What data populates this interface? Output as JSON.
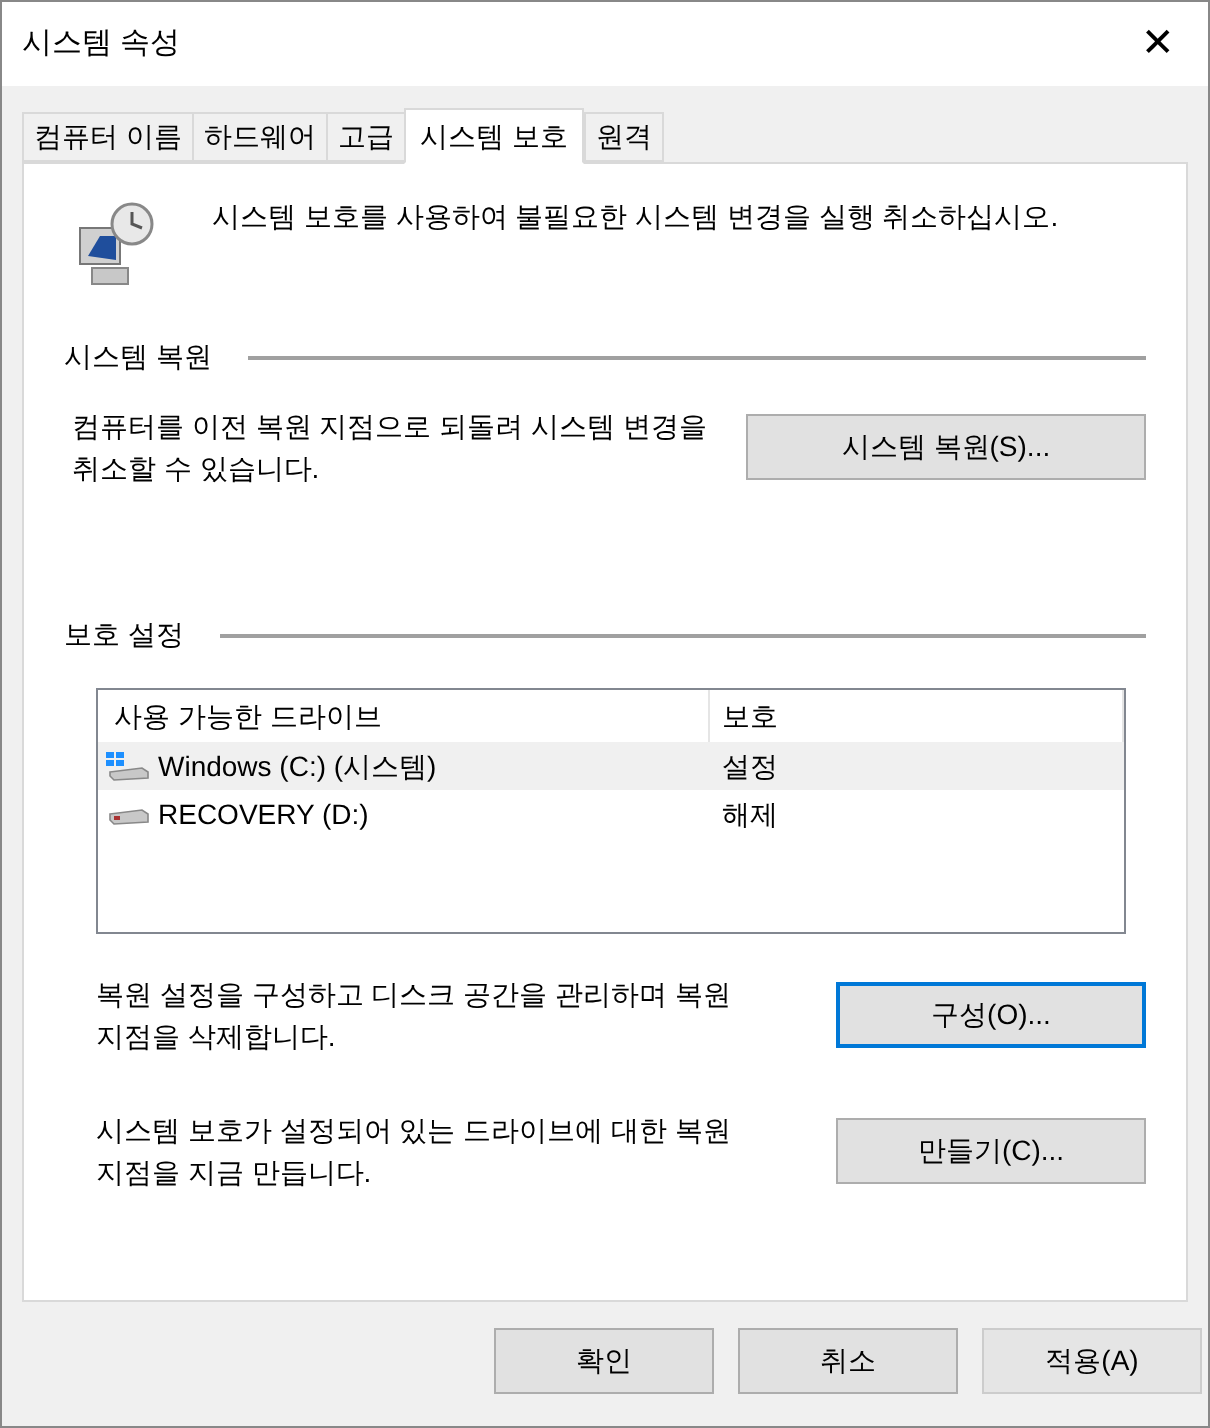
{
  "window": {
    "title": "시스템 속성",
    "close": "✕"
  },
  "tabs": [
    {
      "label": "컴퓨터 이름",
      "selected": false
    },
    {
      "label": "하드웨어",
      "selected": false
    },
    {
      "label": "고급",
      "selected": false
    },
    {
      "label": "시스템 보호",
      "selected": true
    },
    {
      "label": "원격",
      "selected": false
    }
  ],
  "intro": "시스템 보호를 사용하여 불필요한 시스템 변경을 실행 취소하십시오.",
  "restore_section": {
    "title": "시스템 복원",
    "text": "컴퓨터를 이전 복원 지점으로 되돌려 시스템 변경을 취소할 수 있습니다.",
    "button": {
      "label": "시스템 복원(S)...",
      "focused": false,
      "disabled": false
    }
  },
  "protection_section": {
    "title": "보호 설정",
    "columns": [
      "사용 가능한 드라이브",
      "보호"
    ],
    "drives": [
      {
        "kind": "system",
        "name": "Windows (C:) (시스템)",
        "protection": "설정",
        "selected": true
      },
      {
        "kind": "disk",
        "name": "RECOVERY (D:)",
        "protection": "해제",
        "selected": false
      }
    ],
    "actions": [
      {
        "text": "복원 설정을 구성하고 디스크 공간을 관리하며 복원 지점을 삭제합니다.",
        "button": {
          "label": "구성(O)...",
          "focused": true,
          "disabled": false
        }
      },
      {
        "text": "시스템 보호가 설정되어 있는 드라이브에 대한 복원 지점을 지금 만듭니다.",
        "button": {
          "label": "만들기(C)...",
          "focused": false,
          "disabled": false
        }
      }
    ]
  },
  "footer_buttons": [
    {
      "label": "확인",
      "focused": false,
      "disabled": false
    },
    {
      "label": "취소",
      "focused": false,
      "disabled": false
    },
    {
      "label": "적용(A)",
      "focused": false,
      "disabled": true
    }
  ]
}
